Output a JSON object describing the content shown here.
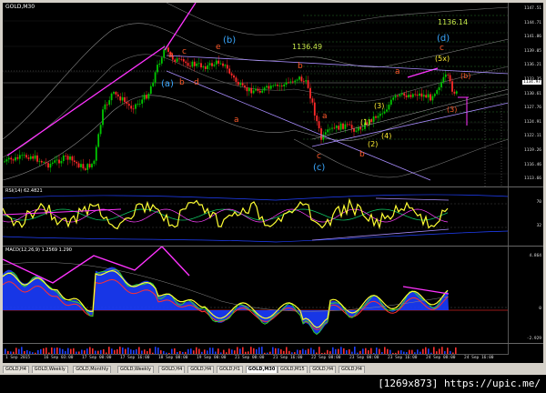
{
  "window": {
    "symbol_title": "GOLD,M30"
  },
  "main_pane": {
    "levels": [
      "1136.14",
      "1136.49"
    ],
    "price_axis": [
      "1147.51",
      "1144.71",
      "1141.86",
      "1139.05",
      "1136.21",
      "1133.35",
      "1130.61",
      "1127.76",
      "1124.91",
      "1122.11",
      "1119.26",
      "1116.46",
      "1113.66"
    ],
    "current_price": "1134.97",
    "wave_labels": {
      "a_paren": "(a)",
      "b_paren": "(b)",
      "c_paren": "(c)",
      "d_paren": "(d)",
      "a": "a",
      "b": "b",
      "c": "c",
      "d": "d",
      "e": "e",
      "w1": "(1)",
      "w2": "(2)",
      "w3": "(3)",
      "w4": "(4)",
      "w5x": "(5x)",
      "r_b": "(b)",
      "r_3": "(3)"
    }
  },
  "rsi_pane": {
    "title": "RSI(14) 62.4821",
    "axis": [
      "70",
      "32"
    ]
  },
  "macd_pane": {
    "title": "MACD(12,26,9) 1.2569 1.290",
    "axis": [
      "4.864",
      "0",
      "-2.929"
    ]
  },
  "time_axis": [
    "1 Sep 2015",
    "16 Sep 03:00",
    "17 Sep 00:00",
    "17 Sep 16:00",
    "18 Sep 08:00",
    "19 Sep 00:00",
    "21 Sep 00:00",
    "21 Sep 16:00",
    "22 Sep 08:00",
    "23 Sep 00:00",
    "23 Sep 16:00",
    "24 Sep 08:00",
    "24 Sep 16:00"
  ],
  "tabs": [
    "GOLD,H4",
    "GOLD,Weekly",
    "GOLD,Monthly",
    "GOLD,Weekly",
    "GOLD,H4",
    "GOLD,H4",
    "GOLD,H1",
    "GOLD,M30",
    "GOLD,M15",
    "GOLD,H4",
    "GOLD,H4"
  ],
  "active_tab": "GOLD,M30",
  "footer": {
    "text": "[1269x873] https://upic.me/"
  },
  "colors": {
    "background": "#000000",
    "candle_up": "#00c800",
    "candle_down": "#ff2a2a",
    "magenta_lines": "#ff33ff",
    "wave_cyan": "#3aa8ff",
    "wave_orange": "#ff5a2a",
    "wave_yellow": "#ffee33",
    "rsi_line": "#ffff33",
    "macd_histogram": "#1a3cff"
  }
}
